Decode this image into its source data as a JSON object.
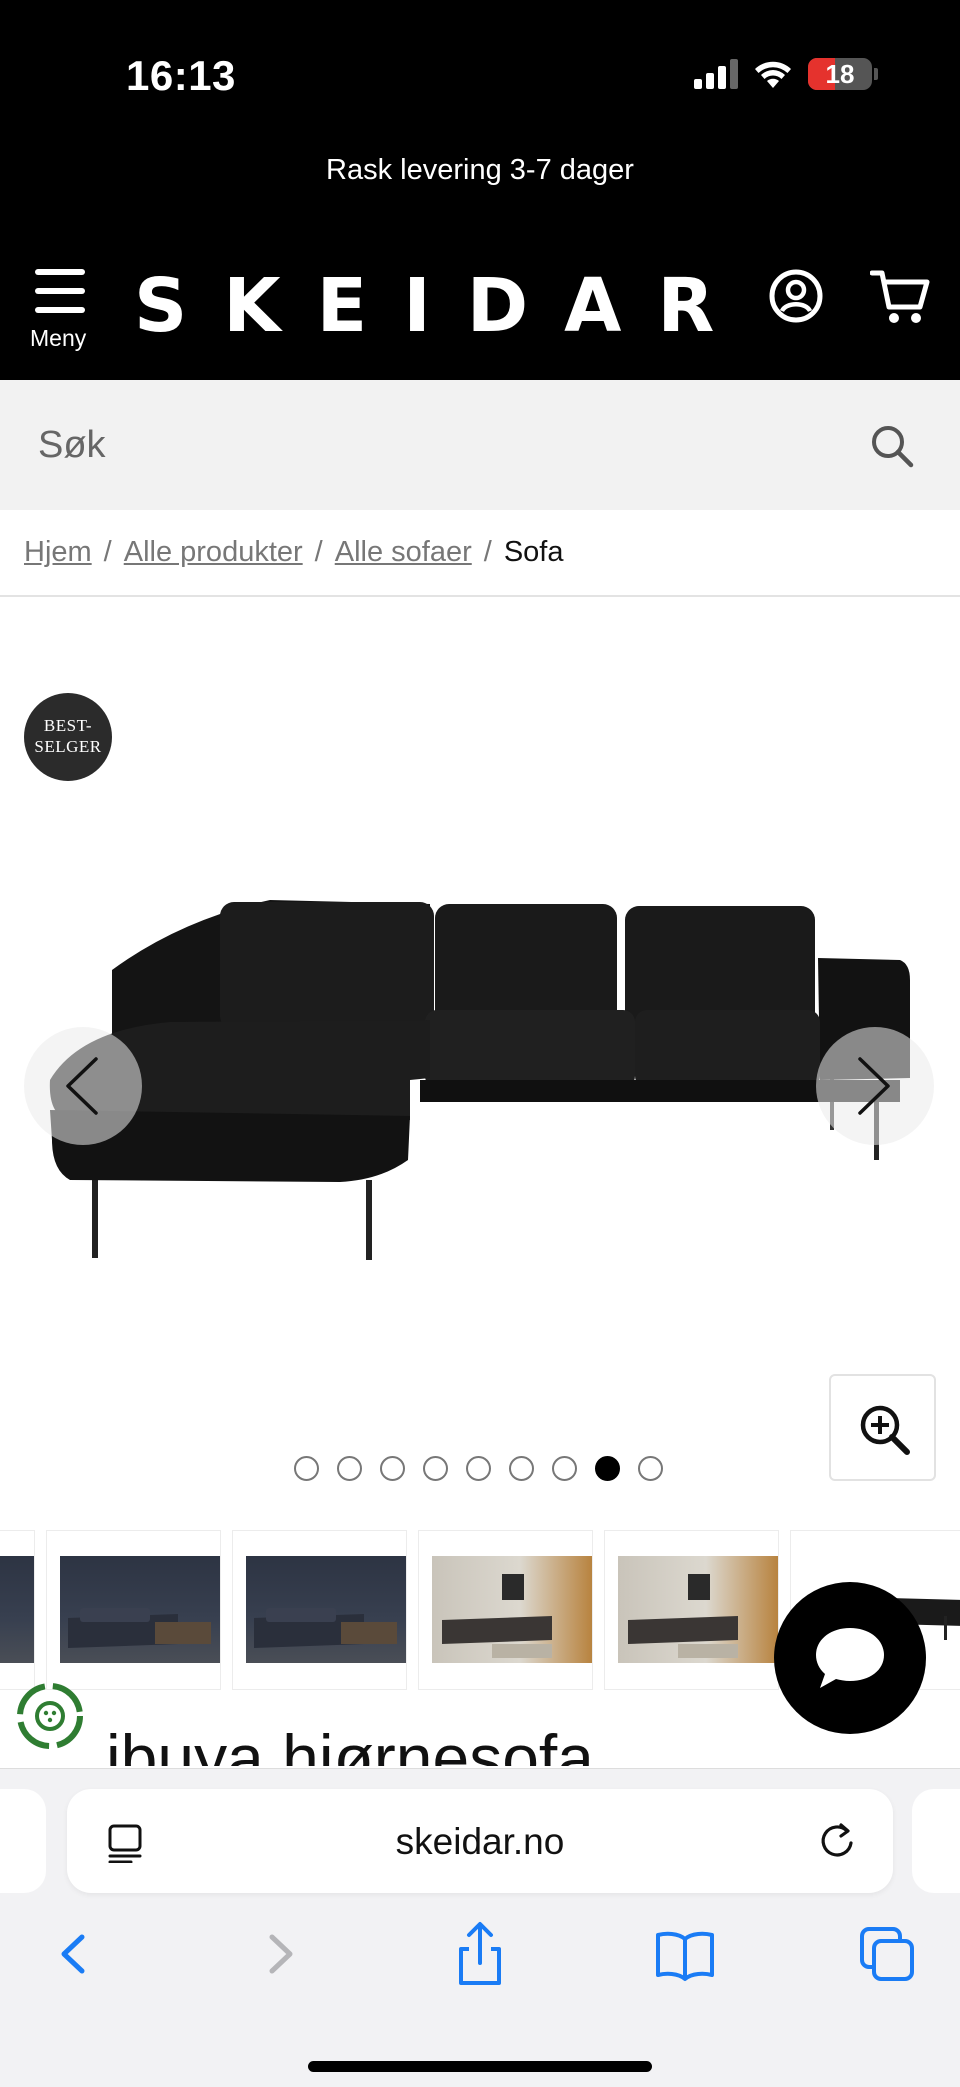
{
  "status_bar": {
    "time": "16:13",
    "battery": "18"
  },
  "promo": {
    "text": "Rask levering 3-7 dager"
  },
  "header": {
    "menu_label": "Meny",
    "logo": "SKEIDAR"
  },
  "search": {
    "placeholder": "Søk"
  },
  "breadcrumb": {
    "items": [
      {
        "label": "Hjem"
      },
      {
        "label": "Alle produkter"
      },
      {
        "label": "Alle sofaer"
      }
    ],
    "current": "Sofa",
    "separator": "/"
  },
  "gallery": {
    "badge_line1": "BEST-",
    "badge_line2": "SELGER",
    "dot_count": 9,
    "active_dot": 8
  },
  "product": {
    "title": "ibuya hjørnesofa"
  },
  "browser": {
    "url": "skeidar.no"
  },
  "colors": {
    "header_bg": "#000000",
    "search_bg": "#f2f2f2",
    "ios_blue": "#1a7cf5",
    "battery_red": "#e5322d"
  },
  "icons": [
    "hamburger-icon",
    "account-icon",
    "cart-icon",
    "search-icon",
    "chevron-left-icon",
    "chevron-right-icon",
    "zoom-in-icon",
    "chat-icon",
    "eco-icon",
    "reader-icon",
    "reload-icon",
    "back-icon",
    "forward-icon",
    "share-icon",
    "bookmarks-icon",
    "tabs-icon"
  ]
}
